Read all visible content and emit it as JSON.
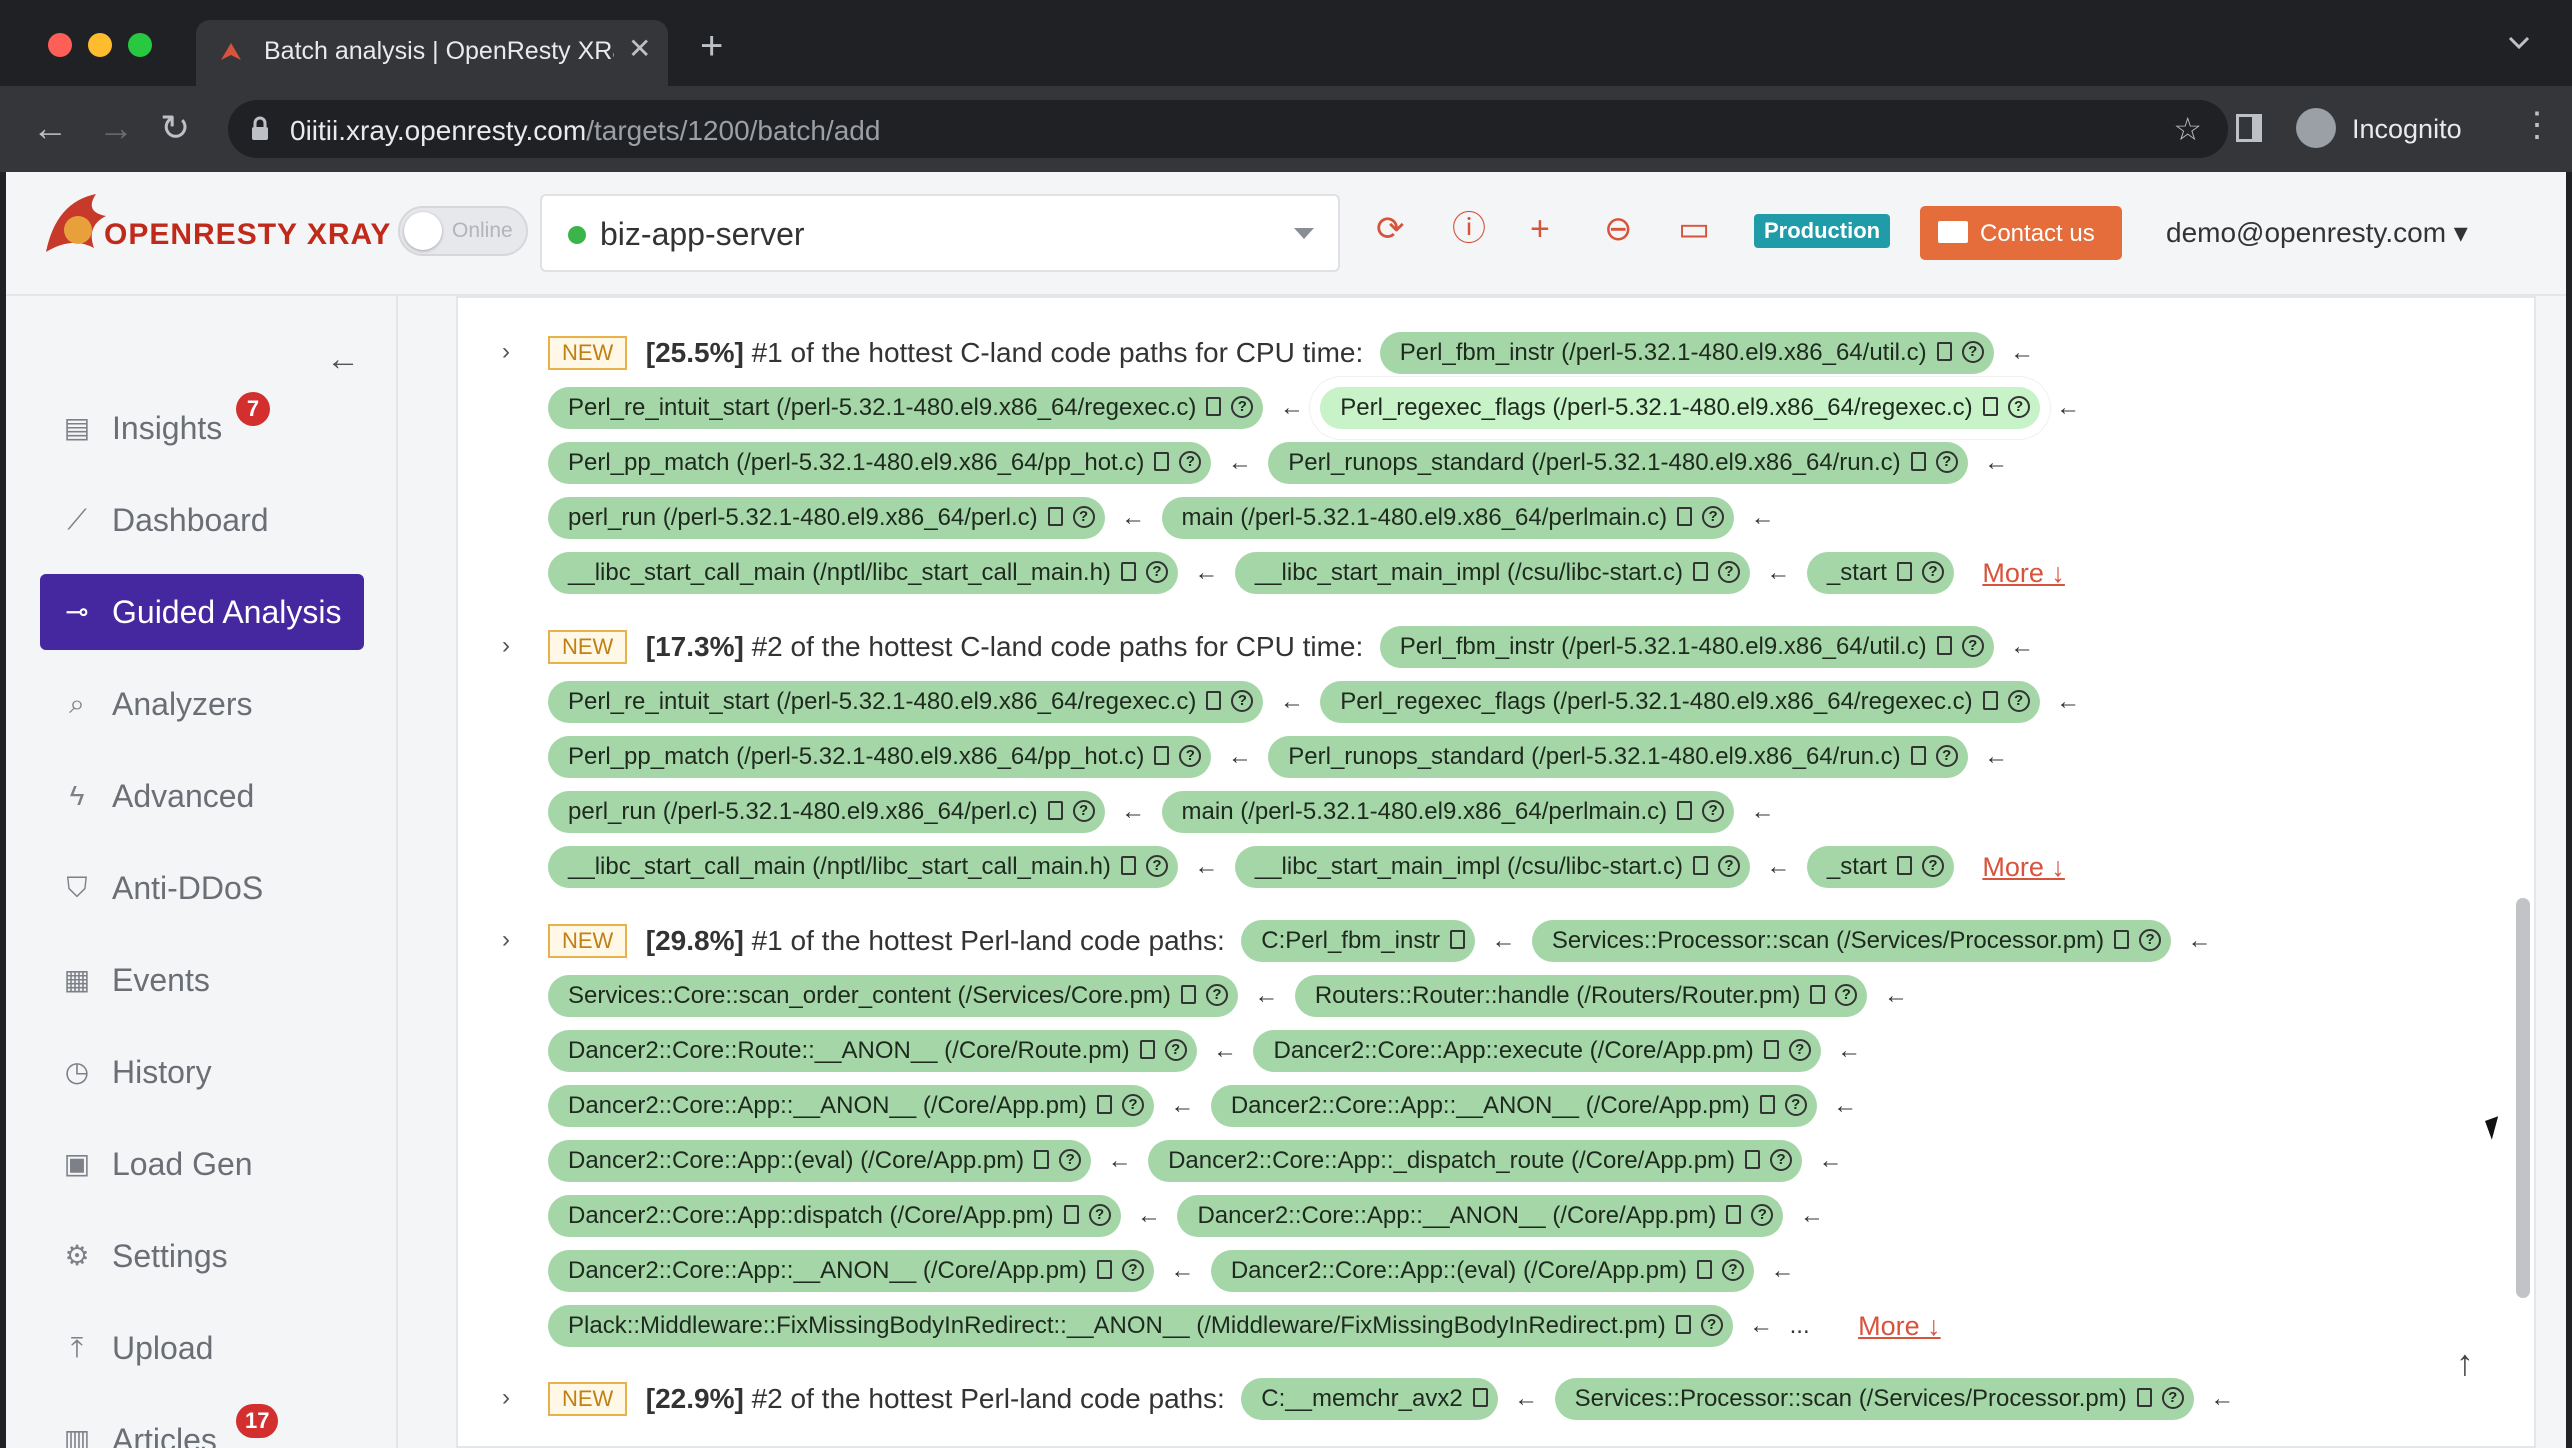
{
  "browser": {
    "tab_title": "Batch analysis | OpenResty XRay",
    "url_host": "0iitii.xray.openresty.com",
    "url_path": "/targets/1200/batch/add",
    "profile_label": "Incognito",
    "colors": {
      "close": "#ff5f57",
      "minimize": "#febc2e",
      "maximize": "#28c840"
    }
  },
  "app": {
    "logo": "OPENRESTY XRAY",
    "toggle_label": "Online",
    "server": "biz-app-server",
    "env_badge": "Production",
    "contact_label": "Contact us",
    "user": "demo@openresty.com"
  },
  "sidebar": {
    "items": [
      {
        "label": "Insights",
        "icon": "document-icon",
        "badge": "7"
      },
      {
        "label": "Dashboard",
        "icon": "chart-icon"
      },
      {
        "label": "Guided Analysis",
        "icon": "key-icon",
        "active": true
      },
      {
        "label": "Analyzers",
        "icon": "search-icon"
      },
      {
        "label": "Advanced",
        "icon": "bolt-icon"
      },
      {
        "label": "Anti-DDoS",
        "icon": "shield-icon"
      },
      {
        "label": "Events",
        "icon": "calendar-icon"
      },
      {
        "label": "History",
        "icon": "clock-icon"
      },
      {
        "label": "Load Gen",
        "icon": "clipboard-icon"
      },
      {
        "label": "Settings",
        "icon": "gear-icon"
      },
      {
        "label": "Upload",
        "icon": "upload-icon"
      },
      {
        "label": "Articles",
        "icon": "book-icon",
        "badge": "17"
      }
    ]
  },
  "content": {
    "new_label": "NEW",
    "more_label": "More ↓",
    "entries": [
      {
        "pct": "[25.5%]",
        "title": "#1 of the hottest C-land code paths for CPU time:",
        "frames": [
          "Perl_fbm_instr (/perl-5.32.1-480.el9.x86_64/util.c)",
          "Perl_re_intuit_start (/perl-5.32.1-480.el9.x86_64/regexec.c)",
          "Perl_regexec_flags (/perl-5.32.1-480.el9.x86_64/regexec.c)",
          "Perl_pp_match (/perl-5.32.1-480.el9.x86_64/pp_hot.c)",
          "Perl_runops_standard (/perl-5.32.1-480.el9.x86_64/run.c)",
          "perl_run (/perl-5.32.1-480.el9.x86_64/perl.c)",
          "main (/perl-5.32.1-480.el9.x86_64/perlmain.c)",
          "__libc_start_call_main (/nptl/libc_start_call_main.h)",
          "__libc_start_main_impl (/csu/libc-start.c)",
          "_start"
        ]
      },
      {
        "pct": "[17.3%]",
        "title": "#2 of the hottest C-land code paths for CPU time:",
        "frames": [
          "Perl_fbm_instr (/perl-5.32.1-480.el9.x86_64/util.c)",
          "Perl_re_intuit_start (/perl-5.32.1-480.el9.x86_64/regexec.c)",
          "Perl_regexec_flags (/perl-5.32.1-480.el9.x86_64/regexec.c)",
          "Perl_pp_match (/perl-5.32.1-480.el9.x86_64/pp_hot.c)",
          "Perl_runops_standard (/perl-5.32.1-480.el9.x86_64/run.c)",
          "perl_run (/perl-5.32.1-480.el9.x86_64/perl.c)",
          "main (/perl-5.32.1-480.el9.x86_64/perlmain.c)",
          "__libc_start_call_main (/nptl/libc_start_call_main.h)",
          "__libc_start_main_impl (/csu/libc-start.c)",
          "_start"
        ]
      },
      {
        "pct": "[29.8%]",
        "title": "#1 of the hottest Perl-land code paths:",
        "frames": [
          "C:Perl_fbm_instr",
          "Services::Processor::scan (/Services/Processor.pm)",
          "Services::Core::scan_order_content (/Services/Core.pm)",
          "Routers::Router::handle (/Routers/Router.pm)",
          "Dancer2::Core::Route::__ANON__ (/Core/Route.pm)",
          "Dancer2::Core::App::execute (/Core/App.pm)",
          "Dancer2::Core::App::__ANON__ (/Core/App.pm)",
          "Dancer2::Core::App::__ANON__ (/Core/App.pm)",
          "Dancer2::Core::App::(eval) (/Core/App.pm)",
          "Dancer2::Core::App::_dispatch_route (/Core/App.pm)",
          "Dancer2::Core::App::dispatch (/Core/App.pm)",
          "Dancer2::Core::App::__ANON__ (/Core/App.pm)",
          "Dancer2::Core::App::__ANON__ (/Core/App.pm)",
          "Dancer2::Core::App::(eval) (/Core/App.pm)",
          "Plack::Middleware::FixMissingBodyInRedirect::__ANON__ (/Middleware/FixMissingBodyInRedirect.pm)"
        ]
      },
      {
        "pct": "[22.9%]",
        "title": "#2 of the hottest Perl-land code paths:",
        "frames": [
          "C:__memchr_avx2",
          "Services::Processor::scan (/Services/Processor.pm)"
        ]
      }
    ]
  }
}
